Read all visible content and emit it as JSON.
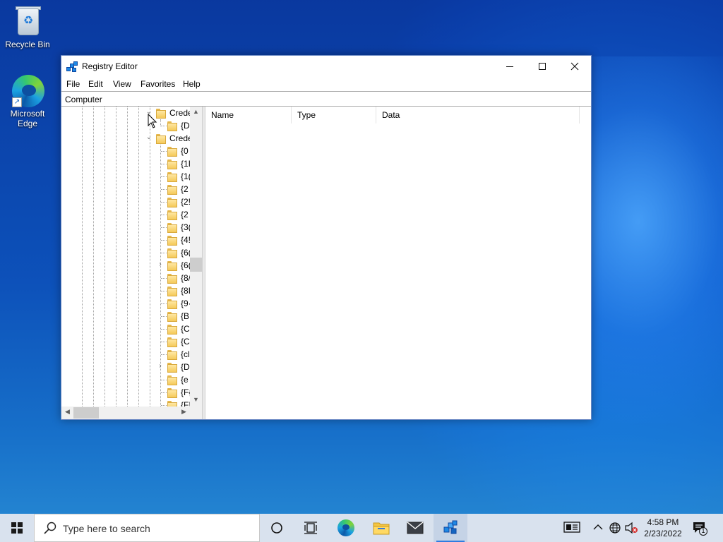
{
  "desktop": {
    "icons": [
      {
        "label": "Recycle Bin"
      },
      {
        "label": "Microsoft Edge"
      }
    ]
  },
  "window": {
    "title": "Registry Editor",
    "menu": [
      "File",
      "Edit",
      "View",
      "Favorites",
      "Help"
    ],
    "address": "Computer",
    "tree": {
      "rows": [
        {
          "label": "Crede",
          "expander": "⌄"
        },
        {
          "label": "{D",
          "expander": ""
        },
        {
          "label": "Crede",
          "expander": "⌄"
        },
        {
          "label": "{0",
          "expander": ""
        },
        {
          "label": "{1I",
          "expander": ""
        },
        {
          "label": "{1(",
          "expander": ""
        },
        {
          "label": "{2",
          "expander": ""
        },
        {
          "label": "{2!",
          "expander": ""
        },
        {
          "label": "{2",
          "expander": ""
        },
        {
          "label": "{3(",
          "expander": ""
        },
        {
          "label": "{4!",
          "expander": ""
        },
        {
          "label": "{6(",
          "expander": ""
        },
        {
          "label": "{6(",
          "expander": "›"
        },
        {
          "label": "{8/",
          "expander": ""
        },
        {
          "label": "{8I",
          "expander": ""
        },
        {
          "label": "{9·",
          "expander": ""
        },
        {
          "label": "{B",
          "expander": ""
        },
        {
          "label": "{C",
          "expander": ""
        },
        {
          "label": "{C",
          "expander": ""
        },
        {
          "label": "{cl",
          "expander": ""
        },
        {
          "label": "{D",
          "expander": "›"
        },
        {
          "label": "{e",
          "expander": ""
        },
        {
          "label": "{F{",
          "expander": ""
        },
        {
          "label": "{F!",
          "expander": ""
        }
      ]
    },
    "columns": [
      "Name",
      "Type",
      "Data"
    ]
  },
  "taskbar": {
    "search_placeholder": "Type here to search",
    "time": "4:58 PM",
    "date": "2/23/2022",
    "notification_count": "1"
  },
  "colors": {
    "accent": "#2f7de1",
    "taskbar": "#d9e2ee",
    "folder": "#f5c95a"
  }
}
